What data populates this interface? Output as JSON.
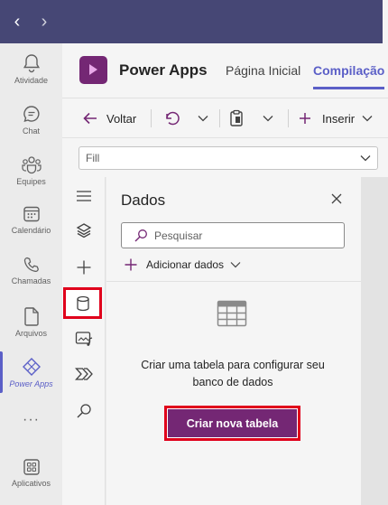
{
  "teams_rail": {
    "items": [
      {
        "label": "Atividade",
        "icon": "bell-icon"
      },
      {
        "label": "Chat",
        "icon": "chat-icon"
      },
      {
        "label": "Equipes",
        "icon": "teams-icon"
      },
      {
        "label": "Calendário",
        "icon": "calendar-icon"
      },
      {
        "label": "Chamadas",
        "icon": "phone-icon"
      },
      {
        "label": "Arquivos",
        "icon": "file-icon"
      },
      {
        "label": "Power Apps",
        "icon": "power-apps-icon",
        "active": true
      },
      {
        "label": "Aplicativos",
        "icon": "apps-icon"
      }
    ],
    "more": "···"
  },
  "header": {
    "app_title": "Power Apps",
    "tabs": [
      {
        "label": "Página Inicial",
        "active": false
      },
      {
        "label": "Compilação",
        "active": true
      }
    ]
  },
  "toolbar": {
    "back_label": "Voltar",
    "insert_label": "Inserir"
  },
  "formula": {
    "property": "Fill"
  },
  "studio_rail": {
    "items": [
      "hamburger-icon",
      "layers-icon",
      "plus-icon",
      "database-icon",
      "media-icon",
      "power-automate-icon",
      "search-icon"
    ],
    "selected": "database-icon"
  },
  "data_panel": {
    "title": "Dados",
    "search_placeholder": "Pesquisar",
    "add_data_label": "Adicionar dados",
    "empty_line1": "Criar uma tabela para configurar seu",
    "empty_line2": "banco de dados",
    "create_button": "Criar nova tabela"
  },
  "colors": {
    "teams_header": "#464775",
    "accent": "#5b5fc7",
    "power_apps_purple": "#742774",
    "highlight": "#e0001b"
  }
}
